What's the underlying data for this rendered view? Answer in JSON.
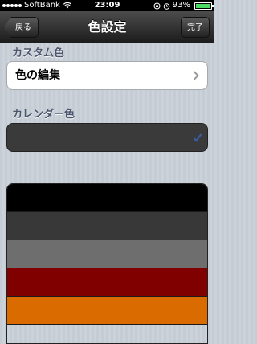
{
  "status_bar": {
    "carrier": "SoftBank",
    "time": "23:09",
    "battery": "93%",
    "battery_level": 0.93
  },
  "nav": {
    "back_label": "戻る",
    "title": "色設定",
    "done_label": "完了"
  },
  "custom_section": {
    "header": "カスタム色",
    "edit_label": "色の編集"
  },
  "calendar_section": {
    "header": "カレンダー色",
    "selected_color": "#3a3a3a"
  },
  "color_options": [
    "#000000",
    "#383838",
    "#6e6e6e",
    "#800000",
    "#d96b00"
  ]
}
